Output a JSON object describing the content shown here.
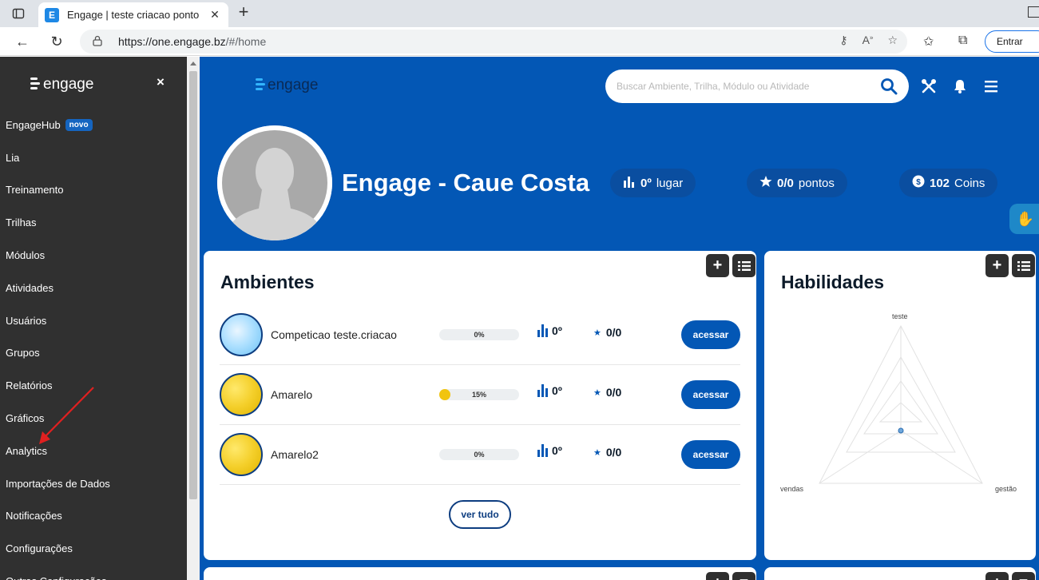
{
  "browser": {
    "tab_title": "Engage | teste criacao ponto",
    "tab_favicon": "E",
    "url_host": "https://one.engage.bz",
    "url_path": "/#/home",
    "entrar_label": "Entrar"
  },
  "sidebar": {
    "logo_text": "engage",
    "close_glyph": "×",
    "items": [
      {
        "label": "EngageHub",
        "badge": "novo"
      },
      {
        "label": "Lia"
      },
      {
        "label": "Treinamento"
      },
      {
        "label": "Trilhas"
      },
      {
        "label": "Módulos"
      },
      {
        "label": "Atividades"
      },
      {
        "label": "Usuários"
      },
      {
        "label": "Grupos"
      },
      {
        "label": "Relatórios"
      },
      {
        "label": "Gráficos"
      },
      {
        "label": "Analytics"
      },
      {
        "label": "Importações de Dados"
      },
      {
        "label": "Notificações"
      },
      {
        "label": "Configurações"
      },
      {
        "label": "Outras Configurações"
      }
    ]
  },
  "header": {
    "logo_text": "engage",
    "search_placeholder": "Buscar Ambiente, Trilha, Módulo ou Atividade"
  },
  "profile": {
    "name": "Engage - Caue Costa",
    "rank_value": "0º",
    "rank_label": "lugar",
    "points_value": "0/0",
    "points_label": "pontos",
    "coins_value": "102",
    "coins_label": "Coins"
  },
  "ambientes": {
    "title": "Ambientes",
    "ver_tudo": "ver tudo",
    "items": [
      {
        "name": "Competicao teste.criacao",
        "progress_label": "0%",
        "progress": 0,
        "rank": "0º",
        "points": "0/0",
        "action": "acessar"
      },
      {
        "name": "Amarelo",
        "progress_label": "15%",
        "progress": 15,
        "rank": "0º",
        "points": "0/0",
        "action": "acessar"
      },
      {
        "name": "Amarelo2",
        "progress_label": "0%",
        "progress": 0,
        "rank": "0º",
        "points": "0/0",
        "action": "acessar"
      }
    ]
  },
  "habilidades": {
    "title": "Habilidades",
    "axes": [
      "teste",
      "vendas",
      "gestão"
    ]
  },
  "colors": {
    "primary": "#0357b5",
    "sidebar_bg": "#303030",
    "progress_fill": "#f1c40f",
    "annotation_arrow": "#e02020"
  }
}
